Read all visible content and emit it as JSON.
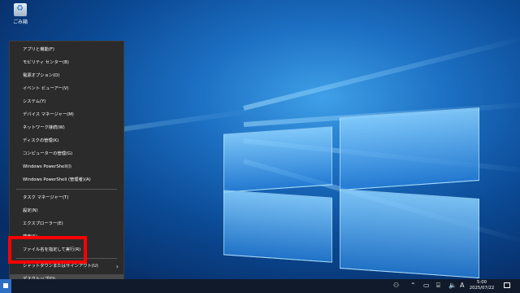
{
  "desktop": {
    "recycle_bin_label": "ごみ箱"
  },
  "menu": {
    "items": [
      {
        "label": "アプリと機能(F)"
      },
      {
        "label": "モビリティ センター(B)"
      },
      {
        "label": "電源オプション(O)"
      },
      {
        "label": "イベント ビューアー(V)"
      },
      {
        "label": "システム(Y)"
      },
      {
        "label": "デバイス マネージャー(M)"
      },
      {
        "label": "ネットワーク接続(W)"
      },
      {
        "label": "ディスクの管理(K)"
      },
      {
        "label": "コンピューターの管理(G)"
      },
      {
        "label": "Windows PowerShell(I)"
      },
      {
        "label": "Windows PowerShell (管理者)(A)"
      },
      {
        "label": "タスク マネージャー(T)"
      },
      {
        "label": "設定(N)"
      },
      {
        "label": "エクスプローラー(E)"
      },
      {
        "label": "検索(S)"
      },
      {
        "label": "ファイル名を指定して実行(R)"
      },
      {
        "label": "シャットダウンまたはサインアウト(U)"
      },
      {
        "label": "デスクトップ(D)"
      }
    ],
    "submenu_arrow": "›"
  },
  "taskbar": {
    "clock_time": "5:00",
    "clock_date": "2025/07/22",
    "ime_indicator": "A"
  }
}
